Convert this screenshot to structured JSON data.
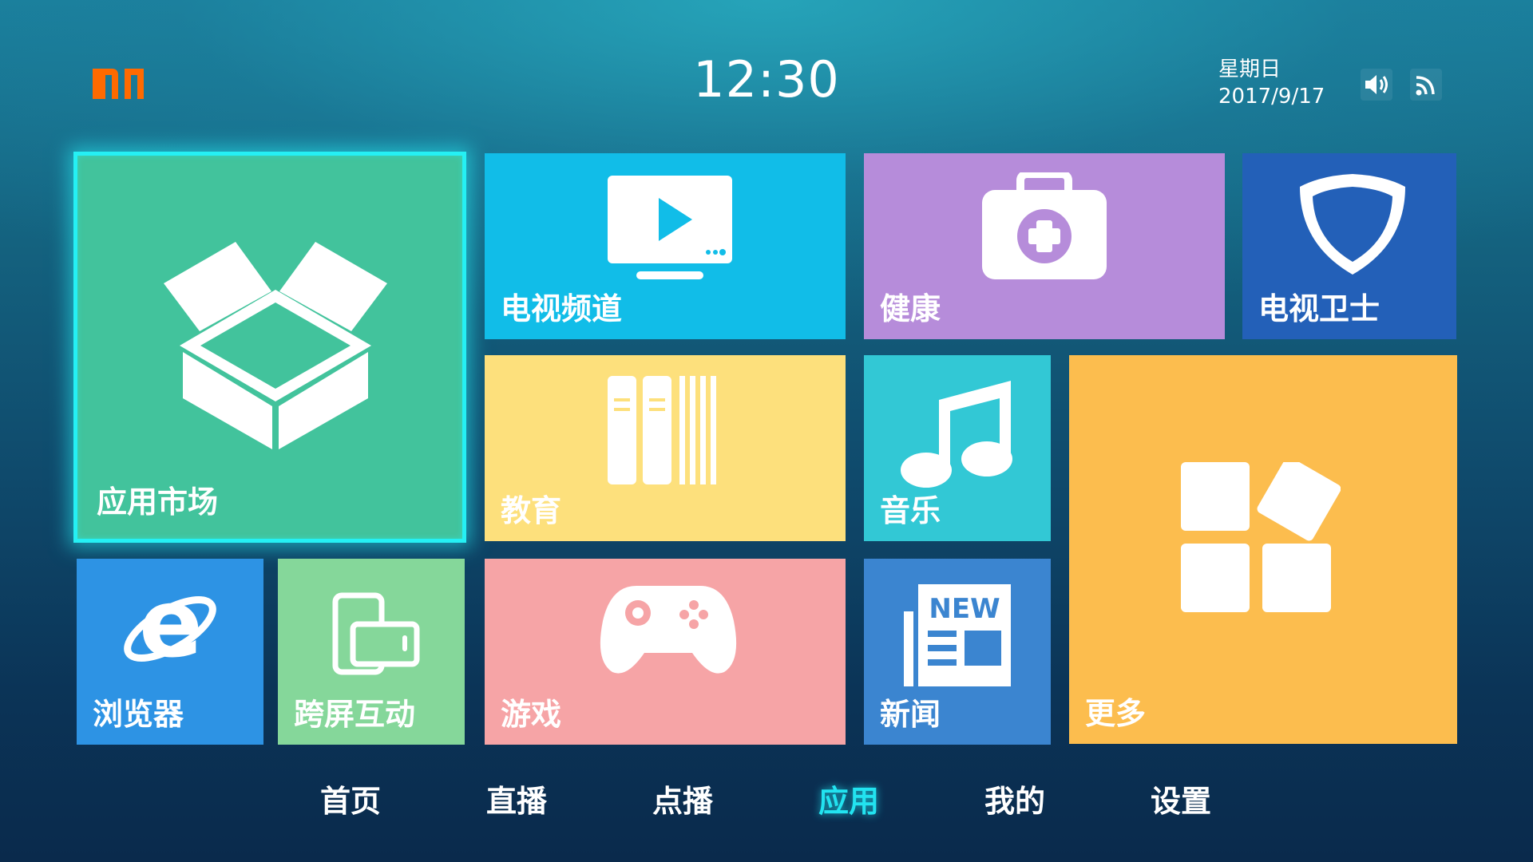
{
  "header": {
    "logo_text": "mi",
    "time": "12:30",
    "weekday": "星期日",
    "date": "2017/9/17",
    "status_icons": [
      "volume-icon",
      "cast-icon"
    ]
  },
  "tiles": {
    "app_market": {
      "label": "应用市场",
      "icon": "box-icon",
      "color": "#42c39c",
      "focused": true
    },
    "tv_channel": {
      "label": "电视频道",
      "icon": "tv-play-icon",
      "color": "#11bde8"
    },
    "health": {
      "label": "健康",
      "icon": "medical-kit-icon",
      "color": "#b68cda"
    },
    "tv_guard": {
      "label": "电视卫士",
      "icon": "shield-icon",
      "color": "#2360b8"
    },
    "education": {
      "label": "教育",
      "icon": "books-icon",
      "color": "#fde07c"
    },
    "music": {
      "label": "音乐",
      "icon": "music-note-icon",
      "color": "#32c8d5"
    },
    "more": {
      "label": "更多",
      "icon": "grid-icon",
      "color": "#fcbd4e"
    },
    "browser": {
      "label": "浏览器",
      "icon": "ie-browser-icon",
      "color": "#2d93e4"
    },
    "cross_screen": {
      "label": "跨屏互动",
      "icon": "devices-icon",
      "color": "#85d79a"
    },
    "games": {
      "label": "游戏",
      "icon": "gamepad-icon",
      "color": "#f6a4a6"
    },
    "news": {
      "label": "新闻",
      "icon": "newspaper-icon",
      "color": "#3b85d0",
      "icon_text": "NEW"
    }
  },
  "nav": {
    "items": [
      {
        "label": "首页",
        "active": false
      },
      {
        "label": "直播",
        "active": false
      },
      {
        "label": "点播",
        "active": false
      },
      {
        "label": "应用",
        "active": true
      },
      {
        "label": "我的",
        "active": false
      },
      {
        "label": "设置",
        "active": false
      }
    ],
    "active_color": "#22e3f0"
  },
  "colors": {
    "accent": "#22e3f0",
    "logo": "#ff6a00"
  }
}
